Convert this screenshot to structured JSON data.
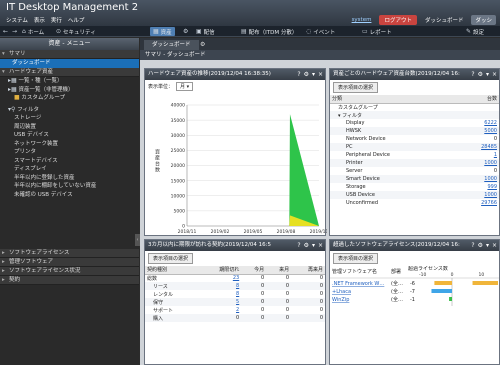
{
  "app": {
    "title": "IT Desktop Management 2",
    "menus": [
      "システム",
      "表示",
      "実行",
      "ヘルプ"
    ],
    "user": "system",
    "logout": "ログアウト",
    "dash_label": "ダッシュボード",
    "dash_pill": "ダッシ"
  },
  "nav": {
    "home": "ホーム",
    "security": "セキュリティ",
    "assets": "資産",
    "distribution": "配信",
    "deploy": "配布（ITDM 分散）",
    "events": "イベント",
    "report": "レポート",
    "settings": "設定"
  },
  "sidebar": {
    "header": "資産 - メニュー",
    "summary": "サマリ",
    "dashboard": "ダッシュボード",
    "hardware": "ハードウェア資産",
    "items": [
      "一覧・種（一覧）",
      "資産一覧（非管理機）",
      "カスタムグループ"
    ],
    "filter": "フィルタ",
    "filter_items": [
      "ストレージ",
      "周辺装置",
      "USB デバイス",
      "ネットワーク装置",
      "プリンタ",
      "スマートデバイス",
      "ディスプレイ",
      "半年以内に登録した資産",
      "半年以内に棚卸をしていない資産",
      "未確認の USB デバイス"
    ],
    "groups": [
      "ソフトウェアライセンス",
      "管理ソフトウェア",
      "ソフトウェアライセンス状況",
      "契約"
    ]
  },
  "main": {
    "tab": "ダッシュボード",
    "crumb": "サマリ - ダッシュボード"
  },
  "panel1": {
    "title": "ハードウェア資産の推移(2019/12/04 16:38:35)",
    "unit_label": "表示単位：",
    "unit_value": "月",
    "ylabel": "資産台数"
  },
  "chart_data": {
    "type": "area",
    "x": [
      "2018/11",
      "2019/02",
      "2019/05",
      "2019/08",
      "2019/11"
    ],
    "ylim": [
      0,
      40000
    ],
    "yticks": [
      0,
      5000,
      10000,
      15000,
      20000,
      25000,
      30000,
      35000,
      40000
    ],
    "ylabel": "資産台数",
    "series": [
      {
        "values": [
          0,
          0,
          0,
          0,
          3500
        ],
        "color": "#e6e022"
      },
      {
        "values": [
          0,
          0,
          0,
          0,
          37000
        ],
        "color": "#2ec44a"
      }
    ]
  },
  "panel2": {
    "title": "資産ごとのハードウェア資産台数(2019/12/04 16:",
    "select_label": "表示項目の選択",
    "col_class": "分類",
    "col_count": "台数",
    "rows": [
      {
        "name": "カスタムグループ",
        "count": "",
        "indent": 1
      },
      {
        "name": "▾ フィルタ",
        "count": "",
        "indent": 1
      },
      {
        "name": "Display",
        "count": "6222",
        "indent": 2
      },
      {
        "name": "HWSK",
        "count": "5000",
        "indent": 2
      },
      {
        "name": "Network Device",
        "count": "0",
        "indent": 2
      },
      {
        "name": "PC",
        "count": "28485",
        "indent": 2
      },
      {
        "name": "Peripheral Device",
        "count": "1",
        "indent": 2
      },
      {
        "name": "Printer",
        "count": "1000",
        "indent": 2
      },
      {
        "name": "Server",
        "count": "0",
        "indent": 2
      },
      {
        "name": "Smart Device",
        "count": "1000",
        "indent": 2
      },
      {
        "name": "Storage",
        "count": "999",
        "indent": 2
      },
      {
        "name": "USB Device",
        "count": "1000",
        "indent": 2
      },
      {
        "name": "Unconfirmed",
        "count": "29766",
        "indent": 2
      }
    ]
  },
  "panel3": {
    "title": "3カ月以内に期限が訪れる契約(2019/12/04 16:5",
    "select_label": "表示項目の選択",
    "cols": [
      "契約種別",
      "期限切れ",
      "今月",
      "来月",
      "再来月"
    ],
    "rows": [
      [
        "総数",
        "23",
        "0",
        "0",
        "0"
      ],
      [
        "リース",
        "8",
        "0",
        "0",
        "0"
      ],
      [
        "レンタル",
        "8",
        "0",
        "0",
        "0"
      ],
      [
        "保守",
        "5",
        "0",
        "0",
        "0"
      ],
      [
        "サポート",
        "2",
        "0",
        "0",
        "0"
      ],
      [
        "購入",
        "0",
        "0",
        "0",
        "0"
      ]
    ]
  },
  "panel4": {
    "title": "超過したソフトウェアライセンス(2019/12/04 16:",
    "select_label": "表示項目の選択",
    "col_software": "管理ソフトウェア名",
    "col_dept": "部署",
    "col_over": "超過ライセンス数",
    "axis_ticks": [
      "-10",
      "0",
      "10"
    ],
    "rows": [
      {
        "name": ".NET Framework W…",
        "dept": "(全…",
        "value": "-6",
        "bar": -6,
        "color": "#f0b53a"
      },
      {
        "name": "+Lhaca",
        "dept": "(全…",
        "value": "-7",
        "bar": -7,
        "color": "#3fa5e8"
      },
      {
        "name": "WinZip",
        "dept": "(全…",
        "value": "-1",
        "bar": -1,
        "color": "#3bbf4a"
      }
    ],
    "overflow_color": "#f0b53a"
  }
}
